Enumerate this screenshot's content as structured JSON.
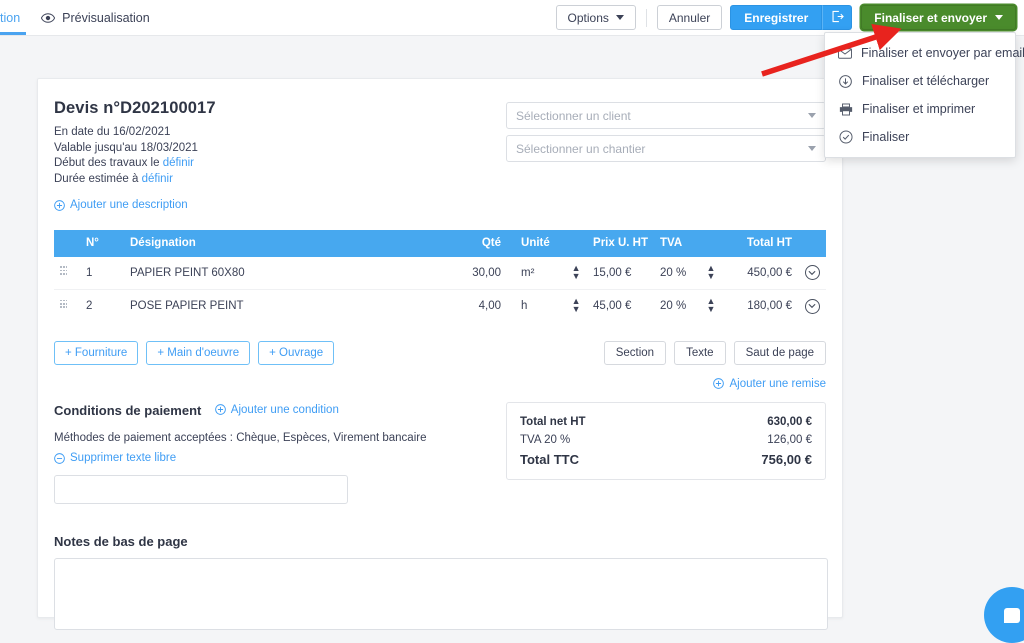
{
  "topbar": {
    "tab_partial_label": "tion",
    "preview_label": "Prévisualisation",
    "preview_icon": "eye-icon",
    "options_label": "Options",
    "cancel_label": "Annuler",
    "save_label": "Enregistrer",
    "save_split_icon": "sign-out-icon",
    "finalize_label": "Finaliser et envoyer",
    "colors": {
      "blue": "#33a0f2",
      "green": "#4a8b2c",
      "tab_active": "#4aa3f0"
    }
  },
  "dropdown": {
    "items": [
      {
        "icon": "envelope-icon",
        "label": "Finaliser et envoyer par email"
      },
      {
        "icon": "cloud-download-icon",
        "label": "Finaliser et télécharger"
      },
      {
        "icon": "printer-icon",
        "label": "Finaliser et imprimer"
      },
      {
        "icon": "check-circle-icon",
        "label": "Finaliser"
      }
    ]
  },
  "document": {
    "title": "Devis n°D202100017",
    "date_line": "En date du 16/02/2021",
    "valid_line": "Valable jusqu'au 18/03/2021",
    "works_start_prefix": "Début des travaux le",
    "works_start_link": "définir",
    "duration_prefix": "Durée estimée à",
    "duration_link": "définir",
    "add_description": "Ajouter une description",
    "client_select_placeholder": "Sélectionner un client",
    "site_select_placeholder": "Sélectionner un chantier"
  },
  "table": {
    "headers": {
      "num": "N°",
      "designation": "Désignation",
      "qty": "Qté",
      "unit": "Unité",
      "unit_price": "Prix U. HT",
      "vat": "TVA",
      "total": "Total HT"
    },
    "rows": [
      {
        "num": "1",
        "designation": "PAPIER PEINT 60X80",
        "qty": "30,00",
        "unit": "m²",
        "unit_price": "15,00 €",
        "vat": "20 %",
        "total": "450,00 €"
      },
      {
        "num": "2",
        "designation": "POSE PAPIER PEINT",
        "qty": "4,00",
        "unit": "h",
        "unit_price": "45,00 €",
        "vat": "20 %",
        "total": "180,00 €"
      }
    ]
  },
  "actions": {
    "add_supply": "+ Fourniture",
    "add_labour": "+ Main d'oeuvre",
    "add_work": "+ Ouvrage",
    "section": "Section",
    "text": "Texte",
    "page_break": "Saut de page",
    "add_discount": "Ajouter une remise"
  },
  "conditions": {
    "title": "Conditions de paiement",
    "add_condition": "Ajouter une condition",
    "methods_text": "Méthodes de paiement acceptées : Chèque, Espèces, Virement bancaire",
    "remove_free_text": "Supprimer texte libre",
    "free_text_value": ""
  },
  "totals": {
    "net_ht_label": "Total net HT",
    "net_ht_value": "630,00 €",
    "vat_label": "TVA 20 %",
    "vat_value": "126,00 €",
    "ttc_label": "Total TTC",
    "ttc_value": "756,00 €"
  },
  "notes": {
    "title": "Notes de bas de page",
    "value": ""
  },
  "annotation": {
    "arrow_color": "#e8231e"
  },
  "chat": {
    "icon": "chat-bubble-icon"
  }
}
